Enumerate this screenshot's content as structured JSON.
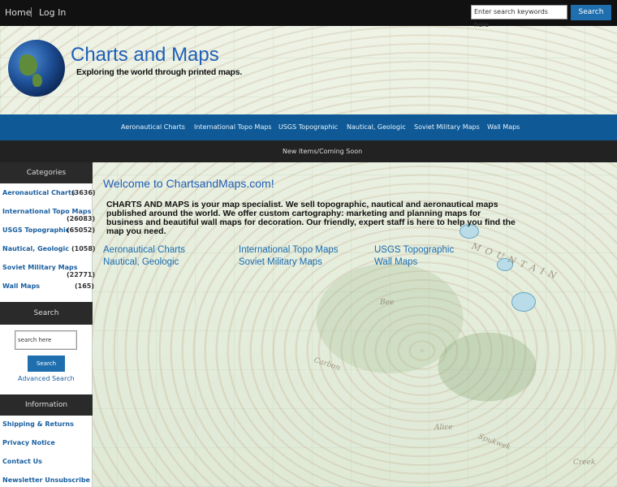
{
  "topbar": {
    "home": "Home",
    "login": "Log In",
    "search_placeholder": "Enter search keywords here",
    "search_button": "Search"
  },
  "header": {
    "title": "Charts and Maps",
    "tagline": "Exploring the world through printed maps."
  },
  "nav": {
    "items": [
      "Aeronautical Charts",
      "International Topo Maps",
      "USGS Topographic",
      "Nautical, Geologic",
      "Soviet Military Maps",
      "Wall Maps"
    ],
    "secondary": "New Items/Coming Soon"
  },
  "sidebar": {
    "categories_heading": "Categories",
    "categories": [
      {
        "label": "Aeronautical Charts",
        "count": "(3636)"
      },
      {
        "label": "International Topo Maps",
        "count": "(26083)"
      },
      {
        "label": "USGS Topographic",
        "count": "(65052)"
      },
      {
        "label": "Nautical, Geologic",
        "count": "(1058)"
      },
      {
        "label": "Soviet Military Maps",
        "count": "(22771)"
      },
      {
        "label": "Wall Maps",
        "count": "(165)"
      }
    ],
    "search_heading": "Search",
    "search_placeholder": "search here",
    "search_button": "Search",
    "advanced_search": "Advanced Search",
    "info_heading": "Information",
    "info_links": [
      "Shipping & Returns",
      "Privacy Notice",
      "Contact Us",
      "Newsletter Unsubscribe"
    ]
  },
  "main": {
    "welcome": "Welcome to ChartsandMaps.com!",
    "intro_strong": "CHARTS AND MAPS",
    "intro_text": " is your map specialist.  We sell topographic, nautical and aeronautical maps published around the world.  We offer custom cartography: marketing and planning maps for business and beautiful wall maps for decoration.  Our friendly, expert staff is here to help you find the map you need.",
    "category_links": [
      "Aeronautical Charts",
      "International Topo Maps",
      "USGS Topographic",
      "Nautical, Geologic",
      "Soviet Military Maps",
      "Wall Maps"
    ]
  },
  "colors": {
    "nav_blue": "#0f5a96",
    "link_blue": "#1a6db0",
    "button_blue": "#1f6fae",
    "dark_bar": "#222222"
  }
}
